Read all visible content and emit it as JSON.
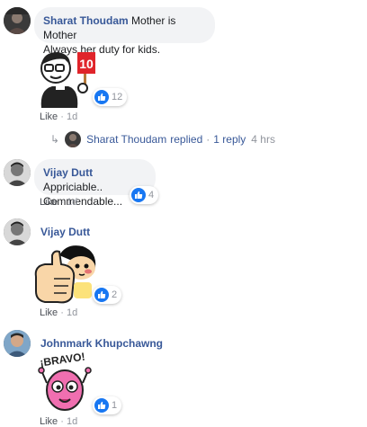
{
  "comments": [
    {
      "author": "Sharat Thoudam",
      "text_line1": "Mother is Mother",
      "text_line2": "Always her duty for kids.",
      "sticker": "10 score sign sticker",
      "reactions": "12",
      "like": "Like",
      "sep": "·",
      "time": "1d"
    },
    {
      "author": "Vijay Dutt",
      "text_line1": "Appriciable..",
      "text_line2": "Commendable...",
      "reactions": "4",
      "like": "Like",
      "sep": "·",
      "time": "1d"
    },
    {
      "author": "Vijay Dutt",
      "sticker": "thumbs up girl sticker",
      "reactions": "2",
      "like": "Like",
      "sep": "·",
      "time": "1d"
    },
    {
      "author": "Johnmark Khupchawng",
      "sticker": "bravo pink creature sticker",
      "sticker_text": "¡BRAVO!",
      "reactions": "1",
      "like": "Like",
      "sep": "·",
      "time": "1d"
    }
  ],
  "reply_summary": {
    "arrow": "↳",
    "author": "Sharat Thoudam",
    "action": "replied",
    "sep": "·",
    "count": "1 reply",
    "time": "4 hrs"
  },
  "colors": {
    "link": "#385898",
    "bubble": "#f2f3f5",
    "meta": "#90949c",
    "reaction": "#1877f2"
  }
}
